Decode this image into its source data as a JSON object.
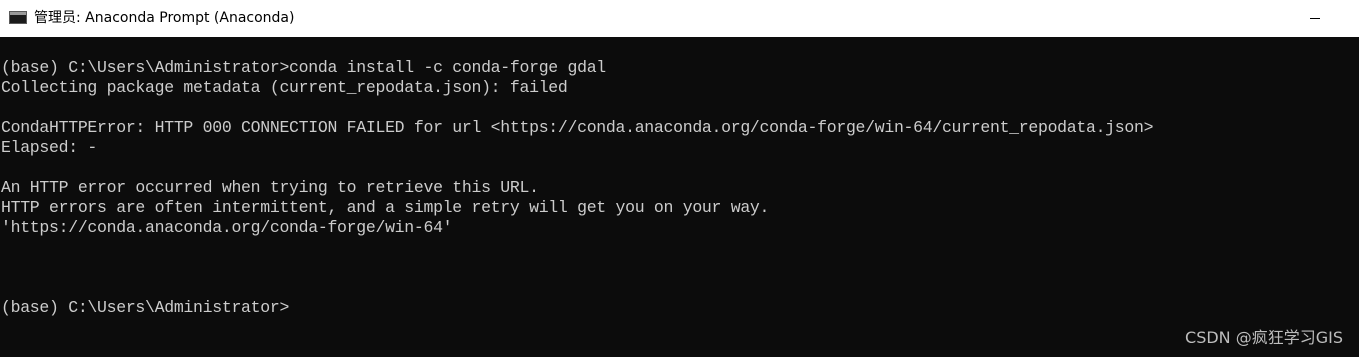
{
  "window": {
    "title": "管理员: Anaconda Prompt (Anaconda)",
    "app_icon": "console-icon"
  },
  "console": {
    "lines": [
      "(base) C:\\Users\\Administrator>conda install -c conda-forge gdal",
      "Collecting package metadata (current_repodata.json): failed",
      "",
      "CondaHTTPError: HTTP 000 CONNECTION FAILED for url <https://conda.anaconda.org/conda-forge/win-64/current_repodata.json>",
      "Elapsed: -",
      "",
      "An HTTP error occurred when trying to retrieve this URL.",
      "HTTP errors are often intermittent, and a simple retry will get you on your way.",
      "'https://conda.anaconda.org/conda-forge/win-64'",
      "",
      "",
      "",
      "(base) C:\\Users\\Administrator>"
    ]
  },
  "watermark": "CSDN @疯狂学习GIS",
  "colors": {
    "console_bg": "#0c0c0c",
    "console_text": "#cccccc",
    "titlebar_bg": "#ffffff"
  }
}
